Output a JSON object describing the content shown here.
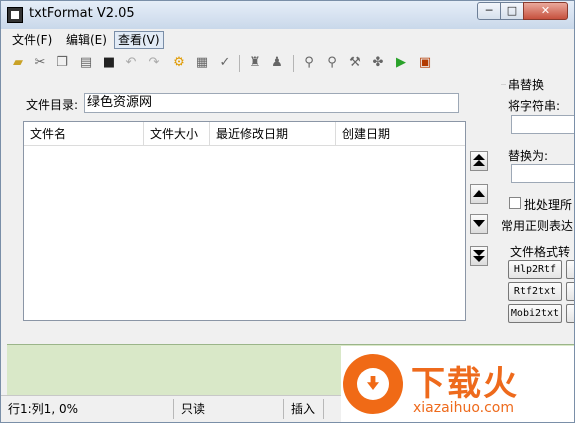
{
  "window": {
    "title": "txtFormat V2.05",
    "minimize": "─",
    "maximize": "□",
    "close": "✕"
  },
  "menu": [
    "文件(F)",
    "编辑(E)",
    "查看(V)"
  ],
  "toolbar_icons": [
    "open-folder-icon",
    "cut-icon",
    "copy-icon",
    "paste-icon",
    "save-icon",
    "undo-icon",
    "redo-icon",
    "settings-gear-icon",
    "format-icon",
    "spellcheck-icon",
    "stamp-icon",
    "stamp-down-icon",
    "find-icon",
    "find-replace-icon",
    "tools-icon",
    "puzzle-icon",
    "run-icon",
    "book-icon"
  ],
  "file_dir": {
    "label": "文件目录:",
    "value": "绿色资源网"
  },
  "file_list": {
    "columns": [
      "文件名",
      "文件大小",
      "最近修改日期",
      "创建日期"
    ],
    "rows": []
  },
  "replace_group": {
    "title": "串替换",
    "find_label": "将字符串:",
    "find_value": "",
    "replace_label": "替换为:",
    "replace_value": ""
  },
  "batch_checkbox": {
    "label": "批处理所",
    "checked": false
  },
  "regex_label": "常用正则表达",
  "convert_group": {
    "title": "文件格式转",
    "buttons": [
      "Hlp2Rtf",
      "Rtf2txt",
      "Mobi2txt"
    ]
  },
  "status": {
    "position": "行1:列1, 0%",
    "readonly": "只读",
    "insert": "插入"
  },
  "watermark": {
    "cn": "下载火",
    "en": "xiazaihuo.com"
  },
  "colors": {
    "status_area_green": "#d9e8c8",
    "watermark_orange": "#f06a16"
  }
}
